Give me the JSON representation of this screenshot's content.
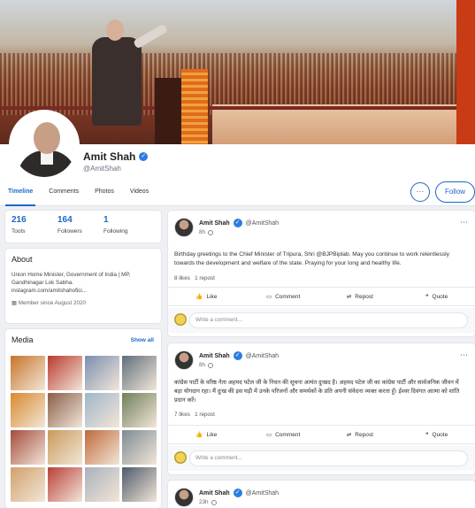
{
  "profile": {
    "name": "Amit Shah",
    "handle": "@AmitShah"
  },
  "tabs": [
    "Timeline",
    "Comments",
    "Photos",
    "Videos"
  ],
  "header": {
    "more_label": "···",
    "follow_label": "Follow"
  },
  "stats": [
    {
      "value": "216",
      "label": "Toots"
    },
    {
      "value": "164",
      "label": "Followers"
    },
    {
      "value": "1",
      "label": "Following"
    }
  ],
  "about": {
    "title": "About",
    "bio_line1": "Union Home Minister, Government of India | MP,",
    "bio_line2": "Gandhinagar Lok Sabha.",
    "bio_line3": "instagram.com/amitshahofici...",
    "member_since": "Member since August 2020"
  },
  "media": {
    "title": "Media",
    "show_all": "Show all",
    "thumb_colors": [
      "#c8742a",
      "#b93a2f",
      "#7a8fb0",
      "#5f6f7b",
      "#d78a2e",
      "#8a5e4a",
      "#9fb6c9",
      "#6f7f5a",
      "#a44b3b",
      "#c99a5c",
      "#bf6a3a",
      "#7d8b92",
      "#d1a06a",
      "#b8403a",
      "#a9b1ba",
      "#4d5b6b"
    ]
  },
  "posts": [
    {
      "name": "Amit Shah",
      "handle": "@AmitShah",
      "time": "8h",
      "text": "Birthday greetings to the Chief Minister of Tripura, Shri @BJPBiplab. May you continue to work relentlessly towards the development and welfare of the state. Praying for your long and healthy life.",
      "likes": "8 likes",
      "reposts": "1 repost"
    },
    {
      "name": "Amit Shah",
      "handle": "@AmitShah",
      "time": "8h",
      "text": "कांग्रेस पार्टी के वरिष्ठ नेता अहमद पटेल जी के निधन की सूचना अत्यंत दुःखद है। अहमद पटेल जी का कांग्रेस पार्टी और सार्वजनिक जीवन में बड़ा योगदान रहा। मैं दुःख की इस घड़ी में उनके परिजनों और समर्थकों के प्रति अपनी संवेदना व्यक्त करता हूँ। ईश्वर दिवंगत आत्मा को शांति प्रदान करें।",
      "likes": "7 likes",
      "reposts": "1 repost"
    },
    {
      "name": "Amit Shah",
      "handle": "@AmitShah",
      "time": "23h"
    }
  ],
  "actions": {
    "like": "Like",
    "comment": "Comment",
    "repost": "Repost",
    "quote": "Quote"
  },
  "comment_placeholder": "Write a comment..."
}
